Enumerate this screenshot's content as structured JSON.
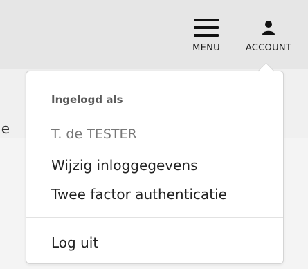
{
  "header": {
    "menu": {
      "label": "MENU",
      "icon": "hamburger-menu-icon"
    },
    "account": {
      "label": "ACCOUNT",
      "icon": "user-icon"
    }
  },
  "background": {
    "peek_text": "e"
  },
  "account_dropdown": {
    "heading": "Ingelogd als",
    "user_name": "T. de TESTER",
    "items": [
      {
        "label": "Wijzig inloggegevens"
      },
      {
        "label": "Twee factor authenticatie"
      }
    ],
    "logout_label": "Log uit"
  },
  "colors": {
    "header_bg": "#e6e6e6",
    "dropdown_bg": "#ffffff",
    "text": "#222222",
    "muted_text": "#777777"
  }
}
